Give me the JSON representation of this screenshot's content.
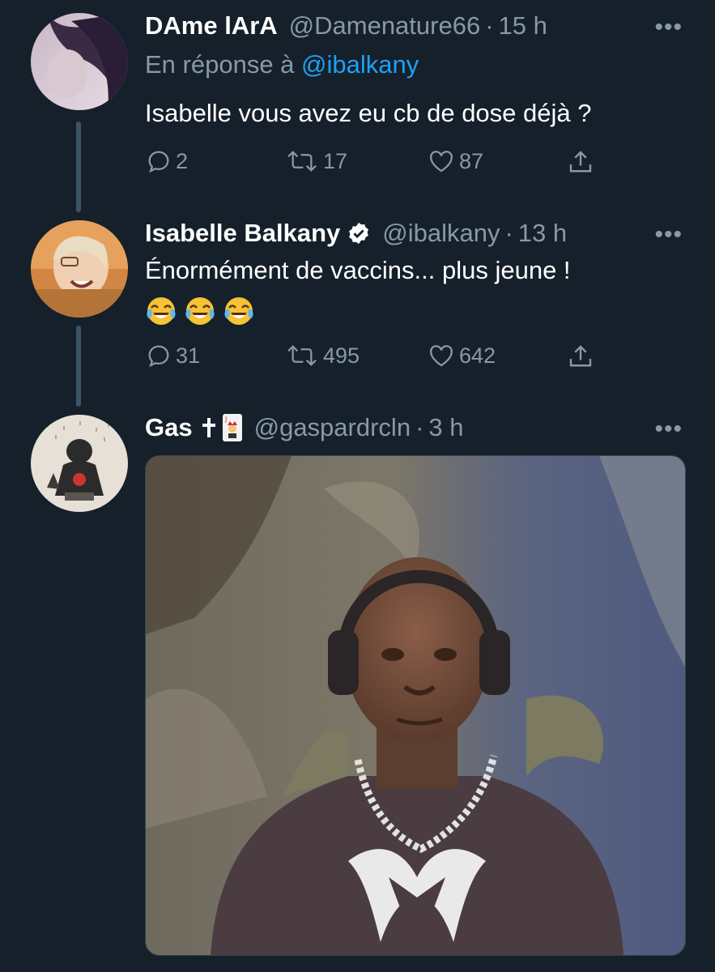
{
  "tweets": [
    {
      "display_name": "DAme lArA",
      "handle": "@Damenature66",
      "separator": "·",
      "time": "15 h",
      "reply_prefix": "En réponse à",
      "reply_mention": "@ibalkany",
      "text": "Isabelle vous avez eu cb de dose déjà ?",
      "replies": "2",
      "retweets": "17",
      "likes": "87"
    },
    {
      "display_name": "Isabelle Balkany",
      "handle": "@ibalkany",
      "separator": "·",
      "time": "13 h",
      "text": "Énormément de vaccins... plus jeune !",
      "emojis": [
        "face-with-tears-of-joy",
        "face-with-tears-of-joy",
        "face-with-tears-of-joy"
      ],
      "replies": "31",
      "retweets": "495",
      "likes": "642"
    },
    {
      "display_name": "Gas",
      "name_emojis": [
        "latin-cross",
        "joker-card"
      ],
      "handle": "@gaspardrcln",
      "separator": "·",
      "time": "3 h"
    }
  ],
  "more_label": "•••",
  "colors": {
    "background": "#15202b",
    "secondary_text": "#8899a6",
    "link": "#1da1f2",
    "thread_line": "#3d5466"
  }
}
